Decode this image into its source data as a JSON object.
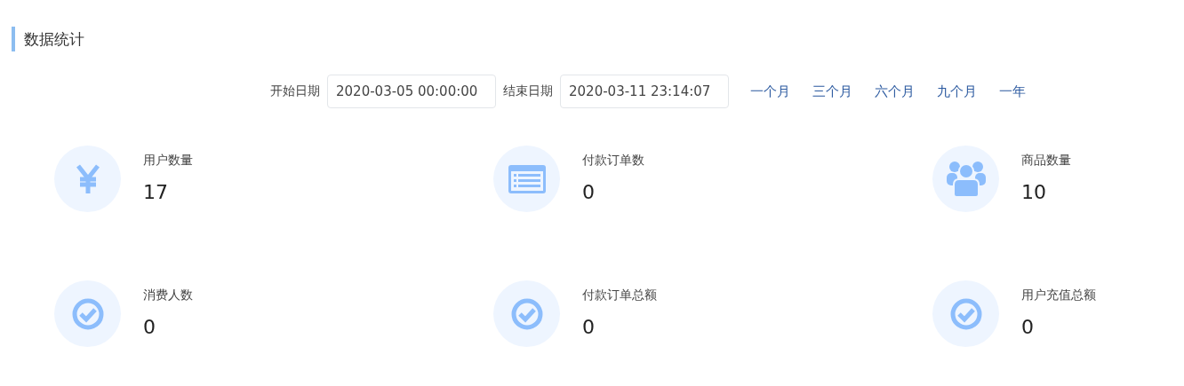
{
  "title": "数据统计",
  "filters": {
    "start_label": "开始日期",
    "start_value": "2020-03-05 00:00:00",
    "end_label": "结束日期",
    "end_value": "2020-03-11 23:14:07",
    "ranges": [
      "一个月",
      "三个月",
      "六个月",
      "九个月",
      "一年"
    ]
  },
  "stats": [
    {
      "kind": "yen",
      "label": "用户数量",
      "value": "17"
    },
    {
      "kind": "list",
      "label": "付款订单数",
      "value": "0"
    },
    {
      "kind": "users",
      "label": "商品数量",
      "value": "10"
    },
    {
      "kind": "check",
      "label": "消费人数",
      "value": "0"
    },
    {
      "kind": "check",
      "label": "付款订单总额",
      "value": "0"
    },
    {
      "kind": "check",
      "label": "用户充值总额",
      "value": "0"
    }
  ]
}
